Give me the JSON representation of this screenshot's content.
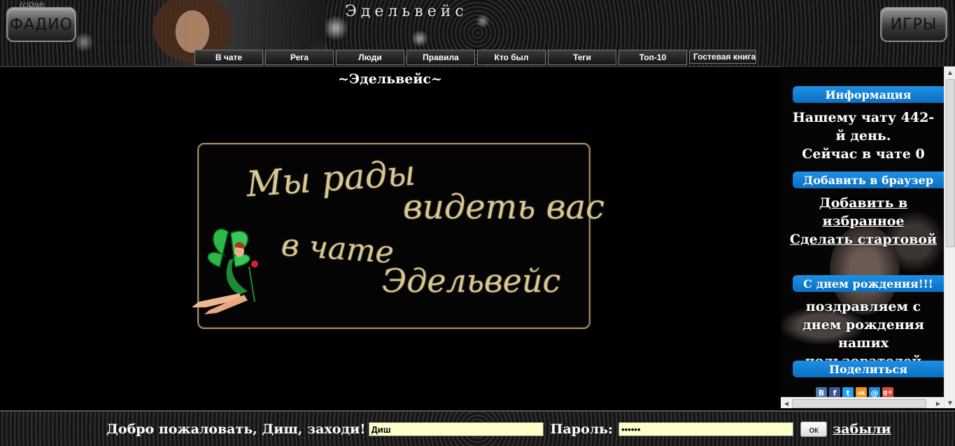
{
  "header": {
    "site_title": "Эдельвейс",
    "radio_label": "ФАДИО",
    "games_label": "ИГРЫ",
    "watermark": "(c)Dish"
  },
  "nav": {
    "items": [
      {
        "label": "В чате"
      },
      {
        "label": "Рега"
      },
      {
        "label": "Люди"
      },
      {
        "label": "Правила"
      },
      {
        "label": "Кто был"
      },
      {
        "label": "Теги"
      },
      {
        "label": "Топ-10"
      },
      {
        "label": "Гостевая книга"
      }
    ]
  },
  "main": {
    "title": "~Эдельвейс~",
    "banner": {
      "line1": "Мы рады",
      "line2": "видеть вас",
      "line3": "в чате",
      "line4": "Эдельвейс"
    }
  },
  "sidebar": {
    "info": {
      "header": "Информация",
      "days_text": "Нашему чату 442-й день.",
      "online_text": "Сейчас в чате 0"
    },
    "browser": {
      "header": "Добавить в браузер",
      "add_favorites": "Добавить в избранное",
      "make_homepage": "Сделать стартовой"
    },
    "birthday": {
      "header": "С днем рождения!!!",
      "text": "поздравляем с днем рождения наших пользователей"
    },
    "share": {
      "header": "Поделиться",
      "icons": [
        {
          "name": "vkontakte-icon",
          "glyph": "B",
          "color": "#4a76a8"
        },
        {
          "name": "facebook-icon",
          "glyph": "f",
          "color": "#3b5998"
        },
        {
          "name": "twitter-icon",
          "glyph": "t",
          "color": "#1da1f2"
        },
        {
          "name": "odnoklassniki-icon",
          "glyph": "ok",
          "color": "#f2931e"
        },
        {
          "name": "mailru-icon",
          "glyph": "@",
          "color": "#168de2"
        },
        {
          "name": "googleplus-icon",
          "glyph": "g+",
          "color": "#dd4b39"
        }
      ]
    }
  },
  "footer": {
    "welcome_text": "Добро пожаловать, Диш, заходи!",
    "name_value": "Диш",
    "password_label": "Пароль:",
    "password_value": "••••••",
    "ok_label": "ок",
    "forgot_label": "забыли"
  }
}
